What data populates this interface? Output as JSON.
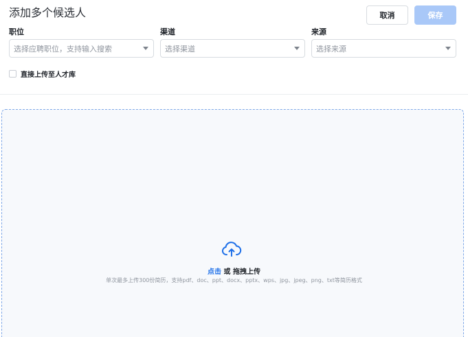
{
  "header": {
    "title": "添加多个候选人",
    "cancel_label": "取消",
    "save_label": "保存"
  },
  "fields": {
    "position": {
      "label": "职位",
      "placeholder": "选择应聘职位，支持输入搜索"
    },
    "channel": {
      "label": "渠道",
      "placeholder": "选择渠道"
    },
    "source": {
      "label": "来源",
      "placeholder": "选择来源"
    }
  },
  "talent_pool": {
    "label": "直接上传至人才库",
    "checked": false
  },
  "upload": {
    "icon": "cloud-upload-icon",
    "click_text": "点击",
    "rest_text": "或 拖拽上传",
    "hint": "单次最多上传300份简历，支持pdf、doc、ppt、docx、pptx、wps、jpg、jpeg、png、txt等简历格式"
  },
  "colors": {
    "accent": "#1d6fe8",
    "save_disabled": "#a9c8f8",
    "dropzone_border": "#7fa8e8"
  }
}
